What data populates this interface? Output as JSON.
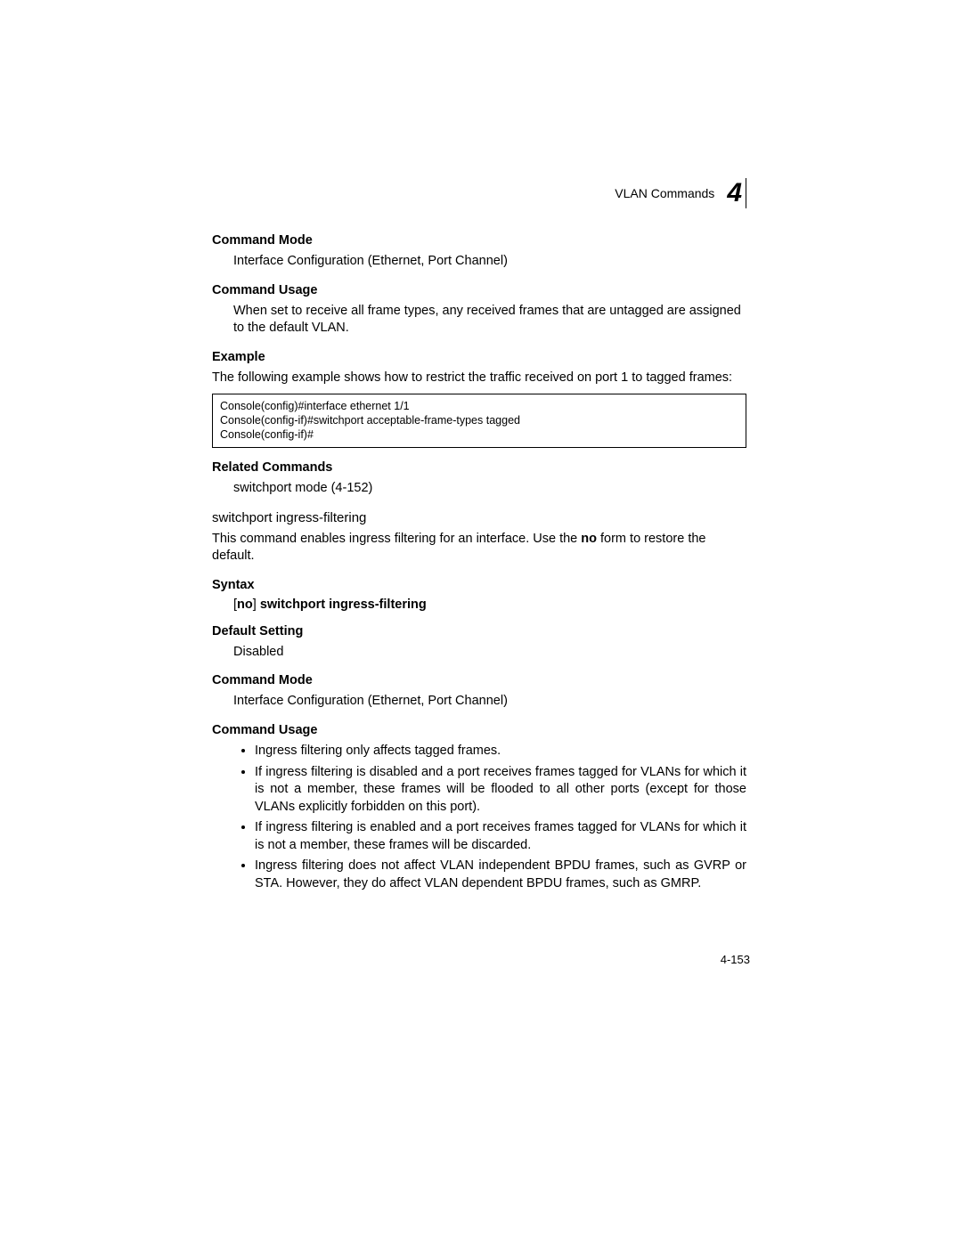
{
  "header": {
    "title": "VLAN Commands",
    "chapter": "4"
  },
  "sections": {
    "cmd_mode_heading_1": "Command Mode",
    "cmd_mode_text_1": "Interface Configuration (Ethernet, Port Channel)",
    "cmd_usage_heading_1": "Command Usage",
    "cmd_usage_text_1": "When set to receive all frame types, any received frames that are untagged are assigned to the default VLAN.",
    "example_heading": "Example",
    "example_text": "The following example shows how to restrict the traffic received on port 1 to tagged frames:",
    "code_block": "Console(config)#interface ethernet 1/1\nConsole(config-if)#switchport acceptable-frame-types tagged\nConsole(config-if)#",
    "related_heading": "Related Commands",
    "related_text": "switchport mode (4-152)",
    "command_title": "switchport ingress-filtering",
    "command_desc_1": "This command enables ingress filtering for an interface. Use the ",
    "command_desc_bold": "no",
    "command_desc_2": " form to restore the default.",
    "syntax_heading": "Syntax",
    "syntax_prefix": "[",
    "syntax_no": "no",
    "syntax_bracket": "] ",
    "syntax_cmd": "switchport ingress-filtering",
    "default_heading": "Default Setting",
    "default_text": "Disabled",
    "cmd_mode_heading_2": "Command Mode",
    "cmd_mode_text_2": "Interface Configuration (Ethernet, Port Channel)",
    "cmd_usage_heading_2": "Command Usage",
    "bullets": [
      "Ingress filtering only affects tagged frames.",
      "If ingress filtering is disabled and a port receives frames tagged for VLANs for which it is not a member, these frames will be flooded to all other ports (except for those VLANs explicitly forbidden on this port).",
      "If ingress filtering is enabled and a port receives frames tagged for VLANs for which it is not a member, these frames will be discarded.",
      "Ingress filtering does not affect VLAN independent BPDU frames, such as GVRP or STA. However, they do affect VLAN dependent BPDU frames, such as GMRP."
    ]
  },
  "page_number": "4-153"
}
